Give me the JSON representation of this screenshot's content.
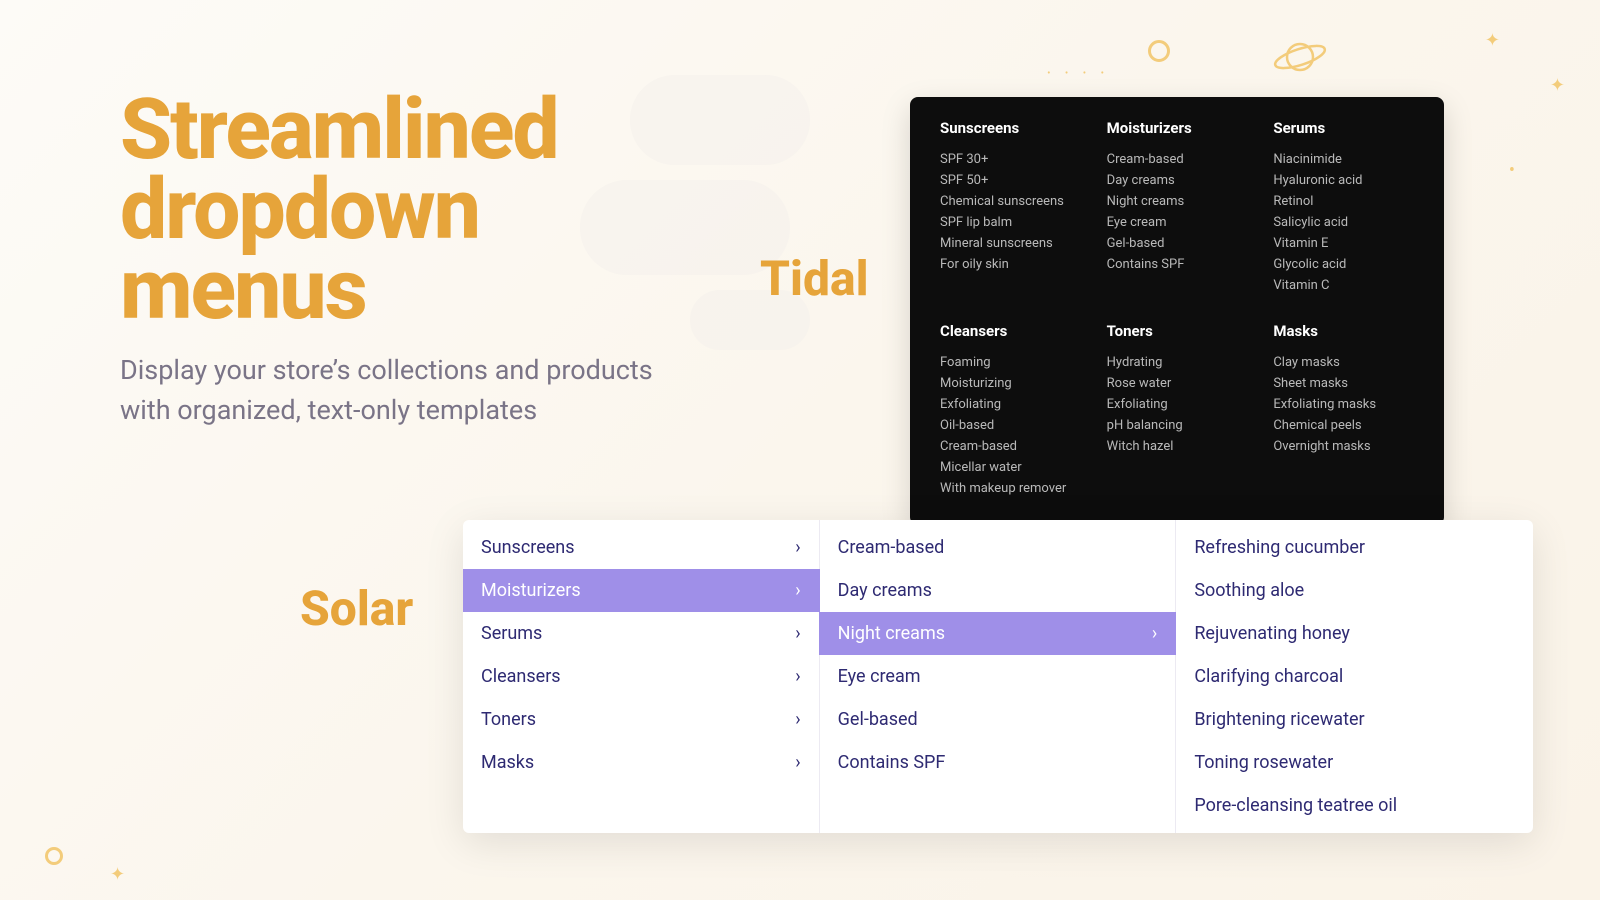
{
  "hero": {
    "title": "Streamlined dropdown menus",
    "subtitle": "Display your store’s collections and products with organized, text-only templates"
  },
  "labels": {
    "tidal": "Tidal",
    "solar": "Solar"
  },
  "tidal": {
    "columns": [
      {
        "title": "Sunscreens",
        "items": [
          "SPF 30+",
          "SPF 50+",
          "Chemical sunscreens",
          "SPF lip balm",
          "Mineral sunscreens",
          "For oily skin"
        ]
      },
      {
        "title": "Moisturizers",
        "items": [
          "Cream-based",
          "Day creams",
          "Night creams",
          "Eye cream",
          "Gel-based",
          "Contains SPF"
        ]
      },
      {
        "title": "Serums",
        "items": [
          "Niacinimide",
          "Hyaluronic acid",
          "Retinol",
          "Salicylic acid",
          "Vitamin E",
          "Glycolic acid",
          "Vitamin C"
        ]
      },
      {
        "title": "Cleansers",
        "items": [
          "Foaming",
          "Moisturizing",
          "Exfoliating",
          "Oil-based",
          "Cream-based",
          "Micellar water",
          "With makeup remover"
        ]
      },
      {
        "title": "Toners",
        "items": [
          "Hydrating",
          "Rose water",
          "Exfoliating",
          "pH balancing",
          "Witch hazel"
        ]
      },
      {
        "title": "Masks",
        "items": [
          "Clay masks",
          "Sheet masks",
          "Exfoliating masks",
          "Chemical peels",
          "Overnight masks"
        ]
      }
    ]
  },
  "solar": {
    "level1": [
      {
        "label": "Sunscreens",
        "hasChildren": true,
        "active": false
      },
      {
        "label": "Moisturizers",
        "hasChildren": true,
        "active": true
      },
      {
        "label": "Serums",
        "hasChildren": true,
        "active": false
      },
      {
        "label": "Cleansers",
        "hasChildren": true,
        "active": false
      },
      {
        "label": "Toners",
        "hasChildren": true,
        "active": false
      },
      {
        "label": "Masks",
        "hasChildren": true,
        "active": false
      }
    ],
    "level2": [
      {
        "label": "Cream-based",
        "hasChildren": false,
        "active": false
      },
      {
        "label": "Day creams",
        "hasChildren": false,
        "active": false
      },
      {
        "label": "Night creams",
        "hasChildren": true,
        "active": true
      },
      {
        "label": "Eye cream",
        "hasChildren": false,
        "active": false
      },
      {
        "label": "Gel-based",
        "hasChildren": false,
        "active": false
      },
      {
        "label": "Contains SPF",
        "hasChildren": false,
        "active": false
      }
    ],
    "level3": [
      {
        "label": "Refreshing cucumber"
      },
      {
        "label": "Soothing aloe"
      },
      {
        "label": "Rejuvenating honey"
      },
      {
        "label": "Clarifying charcoal"
      },
      {
        "label": "Brightening ricewater"
      },
      {
        "label": "Toning rosewater"
      },
      {
        "label": "Pore-cleansing teatree oil"
      }
    ]
  }
}
